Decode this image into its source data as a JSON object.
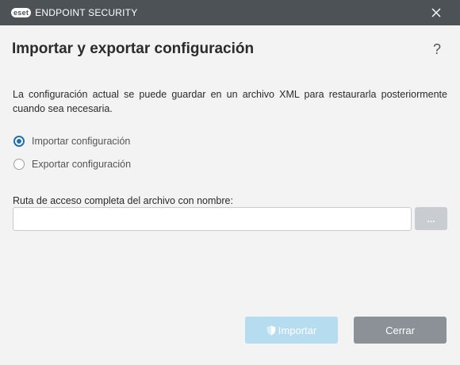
{
  "titlebar": {
    "brand_badge": "eset",
    "product_name": "ENDPOINT SECURITY",
    "close_icon": "close-icon"
  },
  "dialog": {
    "title": "Importar y exportar configuración",
    "help_label": "?",
    "description": "La configuración actual se puede guardar en un archivo XML para restaurarla posteriormente cuando sea necesaria."
  },
  "options": [
    {
      "label": "Importar configuración",
      "selected": true
    },
    {
      "label": "Exportar configuración",
      "selected": false
    }
  ],
  "path_field": {
    "label": "Ruta de acceso completa del archivo con nombre:",
    "value": "",
    "placeholder": "",
    "browse_label": "..."
  },
  "buttons": {
    "import_label": "Importar",
    "import_icon": "shield-icon",
    "close_label": "Cerrar"
  },
  "colors": {
    "titlebar": "#4d5257",
    "background": "#f3f3f4",
    "accent": "#1f6fb2",
    "import_button_disabled": "#b5dcef",
    "close_button": "#8b9196"
  }
}
